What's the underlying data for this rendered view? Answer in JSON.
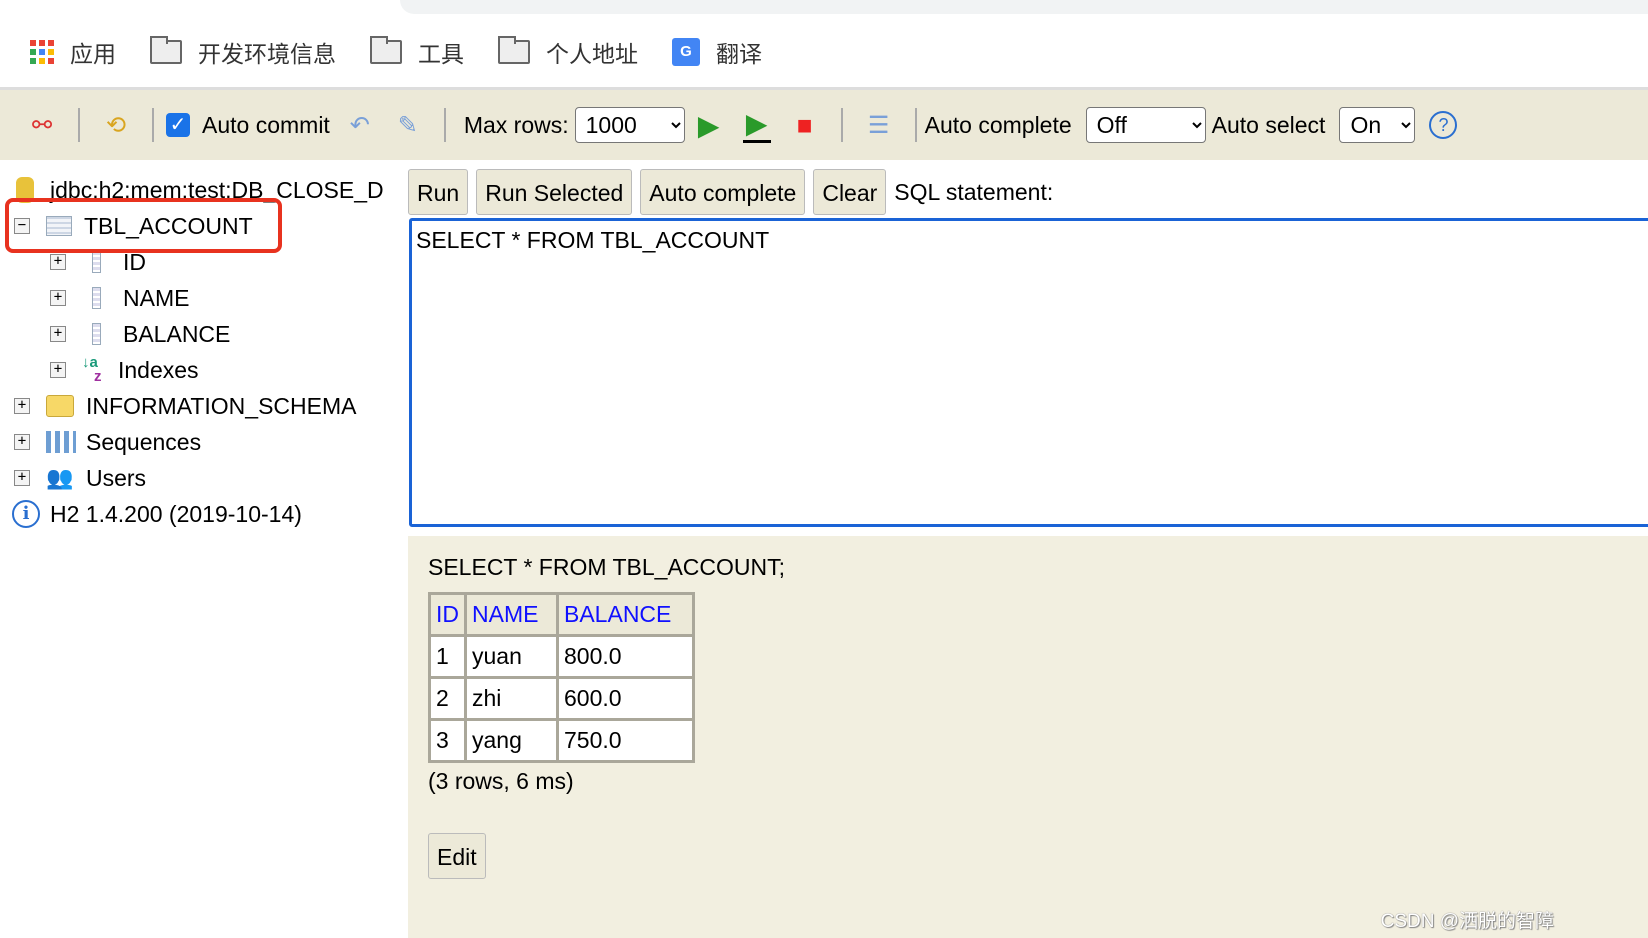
{
  "bookmarks": [
    {
      "label": "应用",
      "icon": "apps-grid-icon"
    },
    {
      "label": "开发环境信息",
      "icon": "folder-icon"
    },
    {
      "label": "工具",
      "icon": "folder-icon"
    },
    {
      "label": "个人地址",
      "icon": "folder-icon"
    },
    {
      "label": "翻译",
      "icon": "google-translate-icon"
    }
  ],
  "toolbar": {
    "auto_commit_label": "Auto commit",
    "auto_commit": true,
    "max_rows_label": "Max rows:",
    "max_rows": "1000",
    "auto_complete_label": "Auto complete",
    "auto_complete": "Off",
    "auto_select_label": "Auto select",
    "auto_select": "On"
  },
  "tree": {
    "connection": "jdbc:h2:mem:test;DB_CLOSE_D",
    "table": "TBL_ACCOUNT",
    "columns": [
      "ID",
      "NAME",
      "BALANCE"
    ],
    "indexes": "Indexes",
    "schema": "INFORMATION_SCHEMA",
    "sequences": "Sequences",
    "users": "Users",
    "version": "H2 1.4.200 (2019-10-14)"
  },
  "editor": {
    "buttons": [
      "Run",
      "Run Selected",
      "Auto complete",
      "Clear"
    ],
    "label": "SQL statement:",
    "sql": "SELECT * FROM TBL_ACCOUNT"
  },
  "results": {
    "statement": "SELECT * FROM TBL_ACCOUNT;",
    "headers": [
      "ID",
      "NAME",
      "BALANCE"
    ],
    "rows": [
      [
        "1",
        "yuan",
        "800.0"
      ],
      [
        "2",
        "zhi",
        "600.0"
      ],
      [
        "3",
        "yang",
        "750.0"
      ]
    ],
    "summary": "(3 rows, 6 ms)",
    "edit_label": "Edit"
  },
  "watermark": "CSDN @洒脱的智障",
  "colors": {
    "toolbar_bg": "#ece9d8",
    "results_bg": "#f2efe0",
    "highlight": "#e8321f",
    "header_text": "#1010ff",
    "editor_border": "#1a63d6"
  }
}
